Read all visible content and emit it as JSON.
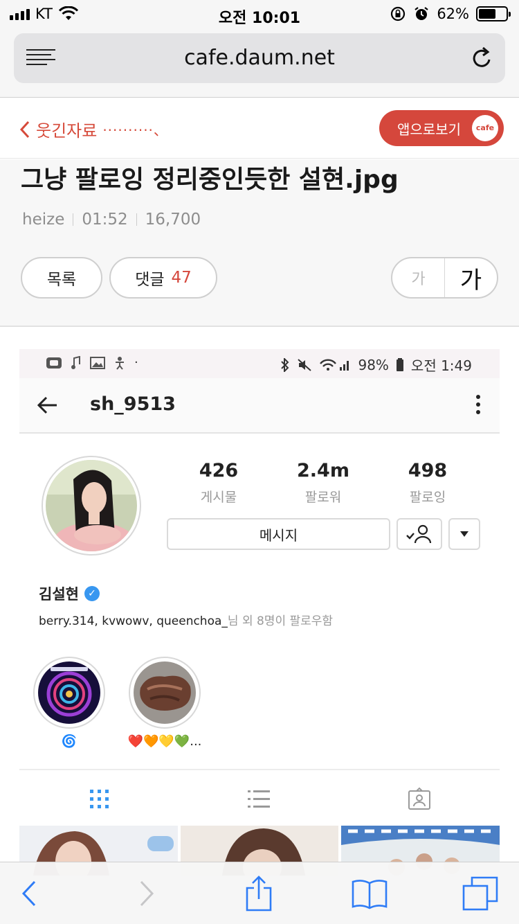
{
  "status_bar": {
    "carrier": "KT",
    "time": "오전 10:01",
    "battery": "62%",
    "battery_level": 0.62,
    "icons": [
      "signal-icon",
      "wifi-icon",
      "orientation-lock-icon",
      "alarm-icon",
      "battery-icon"
    ]
  },
  "browser": {
    "url": "cafe.daum.net",
    "icons": [
      "reader-menu-icon",
      "reload-icon"
    ]
  },
  "cafe_header": {
    "back_label": "웃긴자료",
    "back_suffix": "··········、",
    "app_button_label": "앱으로보기",
    "cafe_badge": "cafe"
  },
  "article": {
    "title": "그냥 팔로잉 정리중인듯한 설현.jpg",
    "author": "heize",
    "time": "01:52",
    "views": "16,700",
    "list_button": "목록",
    "comment_button": "댓글",
    "comment_count": "47",
    "font_small": "가",
    "font_large": "가"
  },
  "embedded": {
    "android_status": {
      "dot": "·",
      "battery": "98%",
      "time": "오전 1:49"
    },
    "ig": {
      "username": "sh_9513",
      "stats": [
        {
          "num": "426",
          "label": "게시물"
        },
        {
          "num": "2.4m",
          "label": "팔로워"
        },
        {
          "num": "498",
          "label": "팔로잉"
        }
      ],
      "message_button": "메시지",
      "name": "김설현",
      "followed_by_names": "berry.314, kvwowv, queenchoa_",
      "followed_by_rest": "님 외 8명이 팔로우함",
      "highlights": [
        {
          "label": "🌀"
        },
        {
          "label": "❤️🧡💛💚..."
        }
      ],
      "tabs": [
        "grid-icon",
        "list-icon",
        "tagged-icon"
      ]
    }
  },
  "toolbar": {
    "icons": [
      "back-icon",
      "forward-icon",
      "share-icon",
      "bookmarks-icon",
      "tabs-icon"
    ]
  },
  "colors": {
    "accent_red": "#d5473c",
    "ig_blue": "#3897f0"
  }
}
